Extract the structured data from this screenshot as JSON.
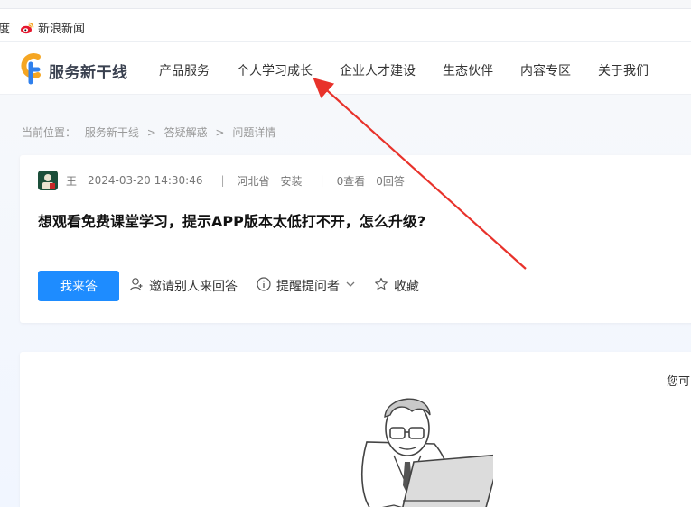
{
  "bookmarks": {
    "left_fragment": "度",
    "weibo_label": "新浪新闻"
  },
  "header": {
    "logo_text": "服务新干线",
    "nav": [
      "产品服务",
      "个人学习成长",
      "企业人才建设",
      "生态伙伴",
      "内容专区",
      "关于我们"
    ]
  },
  "breadcrumb": {
    "prefix": "当前位置：",
    "items": [
      "服务新干线",
      "答疑解惑",
      "问题详情"
    ],
    "separator": ">"
  },
  "question": {
    "author": "王",
    "datetime": "2024-03-20 14:30:46",
    "province": "河北省",
    "city": "安装",
    "views": "0查看",
    "answers": "0回答",
    "divider": "|",
    "title": "想观看免费课堂学习，提示APP版本太低打不开，怎么升级?",
    "answer_btn": "我来答",
    "invite_label": "邀请别人来回答",
    "remind_label": "提醒提问者",
    "favorite_label": "收藏"
  },
  "answer_panel": {
    "tip": "您可"
  },
  "colors": {
    "primary": "#1e8cff",
    "annotation_arrow": "#e8322b",
    "logo_orange": "#f5a623",
    "logo_blue": "#2f80ed"
  },
  "icons": [
    "weibo-icon",
    "logo-icon",
    "avatar-icon",
    "user-invite-icon",
    "info-circle-icon",
    "chevron-down-icon",
    "star-icon",
    "person-laptop-illustration",
    "annotation-arrow"
  ]
}
